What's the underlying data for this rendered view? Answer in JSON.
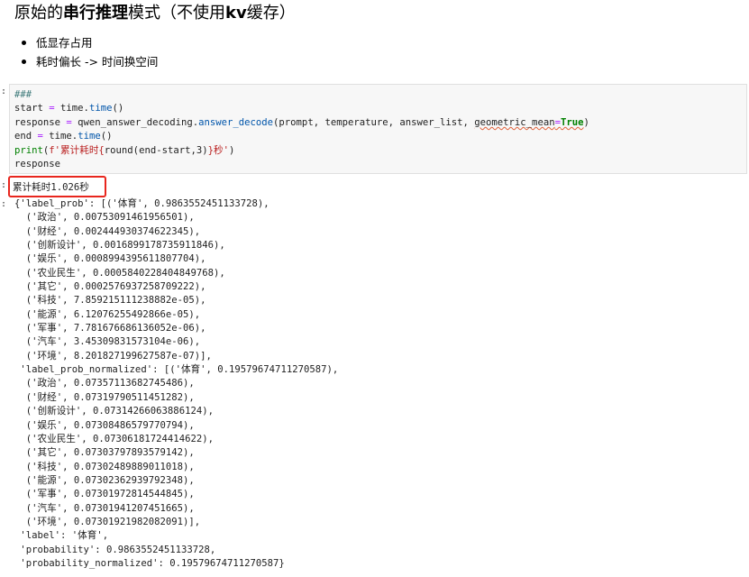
{
  "markdown": {
    "title": {
      "prefix": "原始的",
      "bold": "串行推理",
      "suffix": "模式（不使用",
      "kv": "kv",
      "tail": "缓存）"
    },
    "bullets": [
      "低显存占用",
      "耗时偏长 -> 时间换空间"
    ]
  },
  "code_cell": {
    "prompt": ":",
    "comment": "###",
    "line2": {
      "a": "start ",
      "eq": "=",
      "b": " time.",
      "fn": "time",
      "c": "()"
    },
    "line3": {
      "a": "response ",
      "eq": "=",
      "b": " qwen_answer_decoding.",
      "fn": "answer_decode",
      "c": "(prompt, temperature, answer_list, ",
      "kw_arg": "geometric_mean",
      "eq2": "=",
      "kw": "True",
      "d": ")"
    },
    "line4": {
      "a": "end ",
      "eq": "=",
      "b": " time.",
      "fn": "time",
      "c": "()"
    },
    "line5": {
      "builtin": "print",
      "a": "(",
      "str": "f'累计耗时{",
      "b": "round(end-start,3)",
      "str2": "}秒'",
      "c": ")"
    },
    "line6": "response"
  },
  "output": {
    "stdout_prompt": ":",
    "timing": "累计耗时1.026秒",
    "result_prompt": ":",
    "result_lines": [
      "{'label_prob': [('体育', 0.9863552451133728),",
      "  ('政治', 0.00753091461956501),",
      "  ('财经', 0.002444930374622345),",
      "  ('创新设计', 0.0016899178735911846),",
      "  ('娱乐', 0.0008994395611807704),",
      "  ('农业民生', 0.0005840228404849768),",
      "  ('其它', 0.0002576937258709222),",
      "  ('科技', 7.859215111238882e-05),",
      "  ('能源', 6.12076255492866e-05),",
      "  ('军事', 7.781676686136052e-06),",
      "  ('汽车', 3.45309831573104e-06),",
      "  ('环境', 8.201827199627587e-07)],",
      " 'label_prob_normalized': [('体育', 0.19579674711270587),",
      "  ('政治', 0.07357113682745486),",
      "  ('财经', 0.07319790511451282),",
      "  ('创新设计', 0.07314266063886124),",
      "  ('娱乐', 0.07308486579770794),",
      "  ('农业民生', 0.07306181724414622),",
      "  ('其它', 0.07303797893579142),",
      "  ('科技', 0.07302489889011018),",
      "  ('能源', 0.07302362939792348),",
      "  ('军事', 0.07301972814544845),",
      "  ('汽车', 0.07301941207451665),",
      "  ('环境', 0.07301921982082091)],",
      " 'label': '体育',",
      " 'probability': 0.9863552451133728,",
      " 'probability_normalized': 0.19579674711270587}"
    ]
  },
  "colors": {
    "highlight_box": "#e8261e",
    "code_background": "#f7f7f7"
  }
}
